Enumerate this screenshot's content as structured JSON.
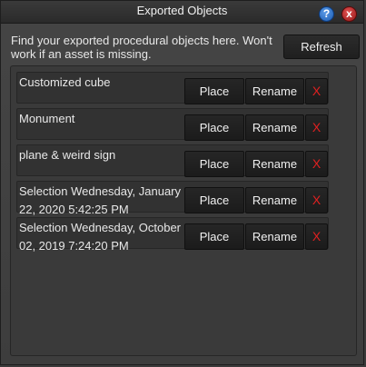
{
  "window": {
    "title": "Exported Objects",
    "help_glyph": "?",
    "close_glyph": "x"
  },
  "info_text": "Find your exported procedural objects here. Won't work if an asset is missing.",
  "refresh_label": "Refresh",
  "row_buttons": {
    "place": "Place",
    "rename": "Rename",
    "delete": "X"
  },
  "objects": [
    {
      "name": "Customized cube"
    },
    {
      "name": "Monument"
    },
    {
      "name": "plane & weird sign"
    },
    {
      "name": "Selection Wednesday, January 22, 2020 5:42:25 PM"
    },
    {
      "name": "Selection Wednesday, October 02, 2019 7:24:20 PM"
    }
  ],
  "colors": {
    "background": "#3a3a3a",
    "delete_red": "#e02020"
  }
}
